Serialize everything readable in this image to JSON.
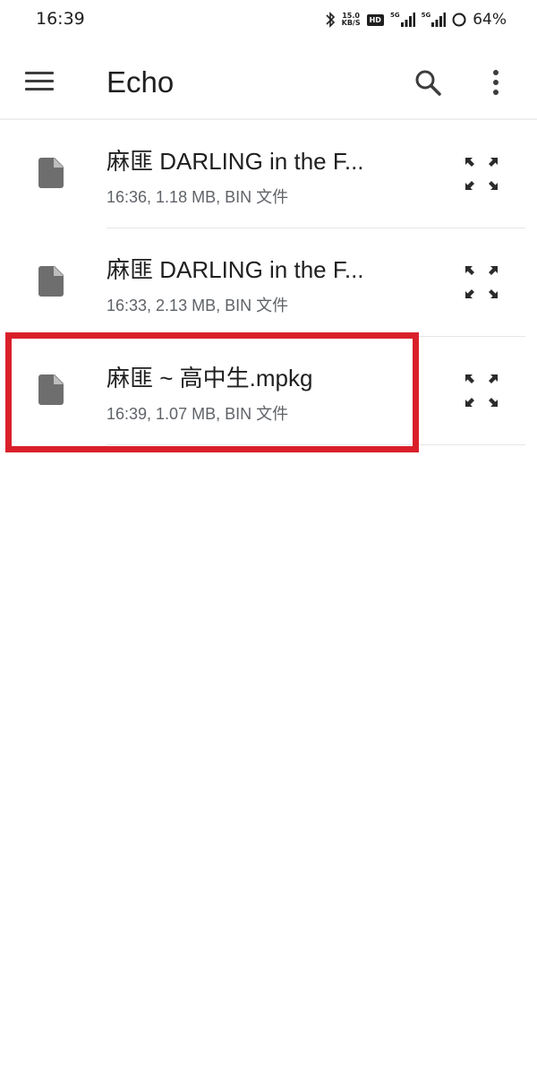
{
  "status_bar": {
    "time": "16:39",
    "net_speed_value": "15.0",
    "net_speed_unit": "KB/S",
    "hd_label": "HD",
    "signal1_label": "5G",
    "signal2_label": "5G",
    "battery": "64%"
  },
  "app_bar": {
    "title": "Echo"
  },
  "files": [
    {
      "name": "麻匪 DARLING in the F...",
      "meta": "16:36, 1.18 MB, BIN 文件"
    },
    {
      "name": "麻匪 DARLING in the F...",
      "meta": "16:33, 2.13 MB, BIN 文件"
    },
    {
      "name": "麻匪 ~ 高中生.mpkg",
      "meta": "16:39, 1.07 MB, BIN 文件"
    }
  ],
  "colors": {
    "highlight": "#d9202a",
    "icon_gray": "#6e6e6e"
  }
}
